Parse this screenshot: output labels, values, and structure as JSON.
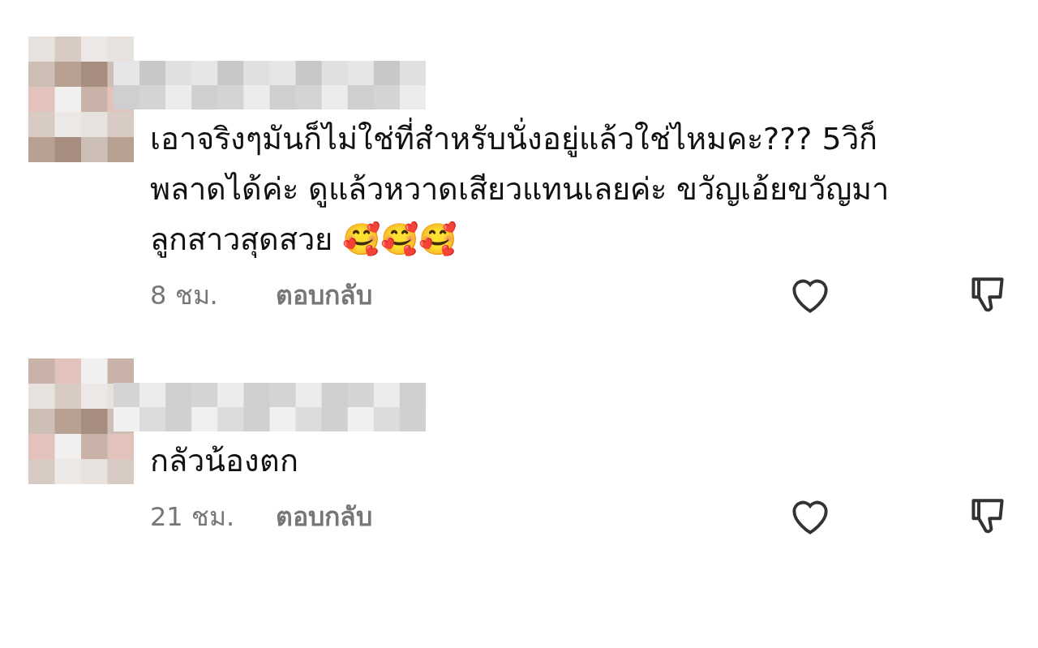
{
  "comments": [
    {
      "text": "เอาจริงๆมันก็ไม่ใช่ที่สำหรับนั่งอยู่แล้วใช่ไหมคะ??? 5วิก็พลาดได้ค่ะ ดูแล้วหวาดเสียวแทนเลยค่ะ ขวัญเอ้ยขวัญมาลูกสาวสุดสวย 🥰🥰🥰",
      "time": "8 ชม.",
      "reply": "ตอบกลับ",
      "liked": false
    },
    {
      "text": "กลัวน้องตก",
      "time": "21 ชม.",
      "reply": "ตอบกลับ",
      "liked": false
    }
  ]
}
